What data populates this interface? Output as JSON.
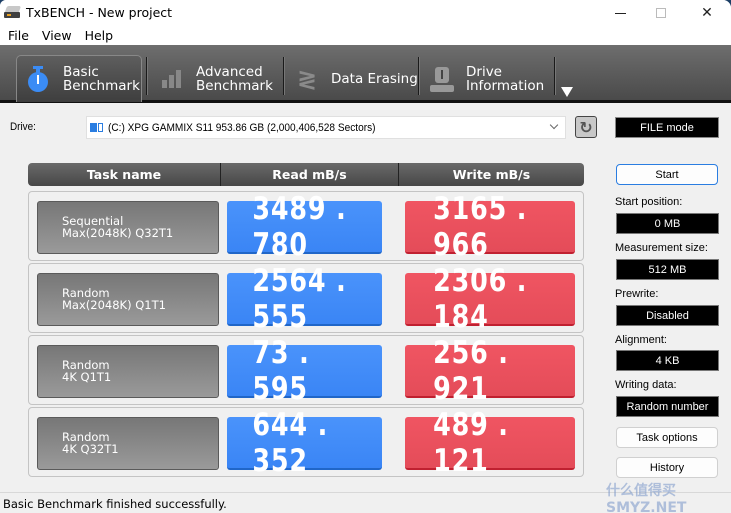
{
  "window": {
    "title": "TxBENCH - New project",
    "controls": {
      "minimize": "minimize",
      "maximize": "maximize",
      "close": "✕"
    }
  },
  "menu": [
    "File",
    "View",
    "Help"
  ],
  "toolbar": {
    "tabs": [
      {
        "line1": "Basic",
        "line2": "Benchmark",
        "icon": "stopwatch-icon",
        "active": true
      },
      {
        "line1": "Advanced",
        "line2": "Benchmark",
        "icon": "bar-chart-icon",
        "active": false
      },
      {
        "line1": "Data Erasing",
        "line2": "",
        "icon": "spring-erase-icon",
        "active": false
      },
      {
        "line1": "Drive",
        "line2": "Information",
        "icon": "drive-info-icon",
        "active": false
      }
    ],
    "more_icon": "dropdown-arrow-icon"
  },
  "drive": {
    "label": "Drive:",
    "selected": "(C:) XPG GAMMIX S11  953.86 GB (2,000,406,528 Sectors)",
    "refresh_icon": "refresh-icon",
    "mode": "FILE mode"
  },
  "table": {
    "headers": [
      "Task name",
      "Read mB/s",
      "Write mB/s"
    ],
    "rows": [
      {
        "line1": "Sequential",
        "line2": "Max(2048K) Q32T1",
        "read": "3489.780",
        "write": "3165.966"
      },
      {
        "line1": "Random",
        "line2": "Max(2048K) Q1T1",
        "read": "2564.555",
        "write": "2306.184"
      },
      {
        "line1": "Random",
        "line2": "4K Q1T1",
        "read": "73.595",
        "write": "256.921"
      },
      {
        "line1": "Random",
        "line2": "4K Q32T1",
        "read": "644.352",
        "write": "489.121"
      }
    ]
  },
  "panel": {
    "start": "Start",
    "start_position_label": "Start position:",
    "start_position": "0 MB",
    "measurement_size_label": "Measurement size:",
    "measurement_size": "512 MB",
    "prewrite_label": "Prewrite:",
    "prewrite": "Disabled",
    "alignment_label": "Alignment:",
    "alignment": "4 KB",
    "writing_data_label": "Writing data:",
    "writing_data": "Random number",
    "task_options": "Task options",
    "history": "History"
  },
  "status": "Basic Benchmark finished successfully.",
  "watermark": "什么值得买 SMYZ.NET",
  "colors": {
    "read": "#3f8cf8",
    "write": "#ea5060",
    "accent": "#2a7de1"
  }
}
